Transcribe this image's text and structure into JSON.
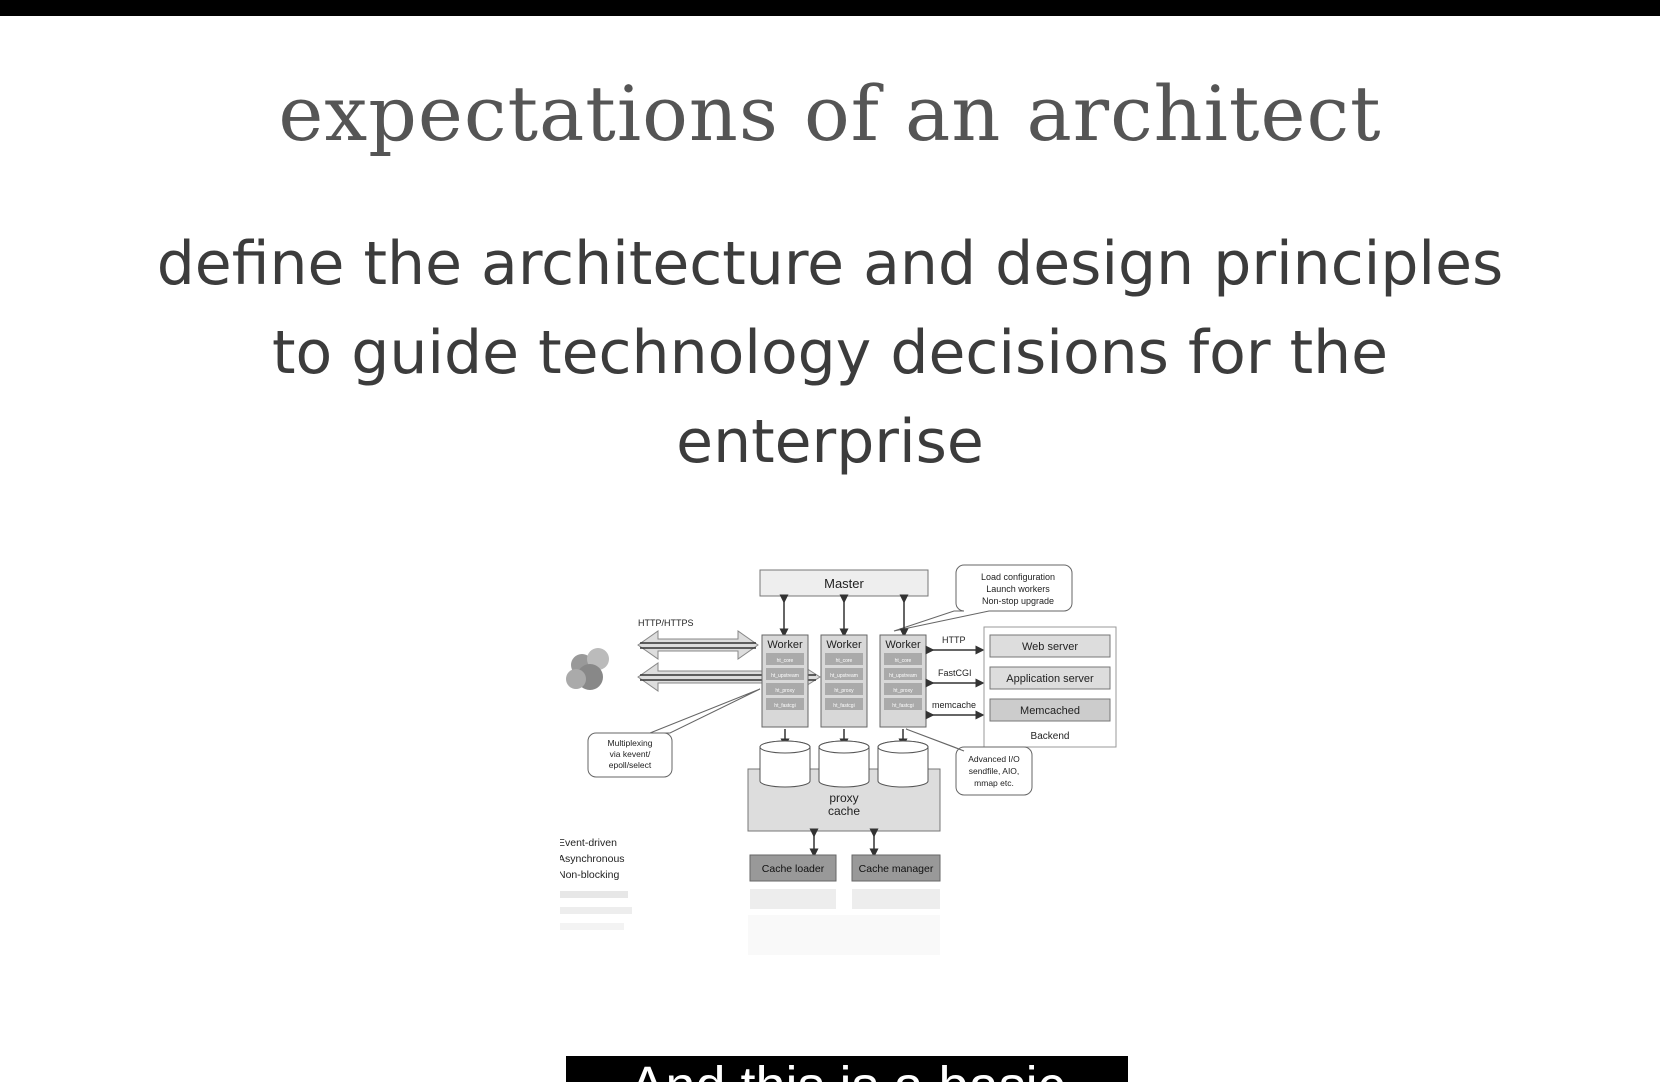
{
  "slide": {
    "title": "expectations of an architect",
    "subtitle_lines": [
      "define the architecture and design principles",
      "to guide technology decisions for the",
      "enterprise"
    ]
  },
  "diagram": {
    "master": "Master",
    "master_note": [
      "Load configuration",
      "Launch workers",
      "Non-stop upgrade"
    ],
    "protocol_label": "HTTP/HTTPS",
    "worker_label": "Worker",
    "worker_modules": [
      "ht_core",
      "ht_upstream",
      "ht_proxy",
      "ht_fastcgi"
    ],
    "backend_protocols": [
      "HTTP",
      "FastCGI",
      "memcache"
    ],
    "backend_items": [
      "Web server",
      "Application server",
      "Memcached"
    ],
    "backend_label": "Backend",
    "multiplex_note": [
      "Multiplexing",
      "via kevent/",
      "epoll/select"
    ],
    "io_note": [
      "Advanced I/O",
      "sendfile, AIO,",
      "mmap etc."
    ],
    "cache_label": [
      "proxy",
      "cache"
    ],
    "cache_loader": "Cache loader",
    "cache_manager": "Cache manager",
    "legend": [
      "Event-driven",
      "Asynchronous",
      "Non-blocking"
    ]
  },
  "caption": {
    "text": "And this is a basic"
  }
}
